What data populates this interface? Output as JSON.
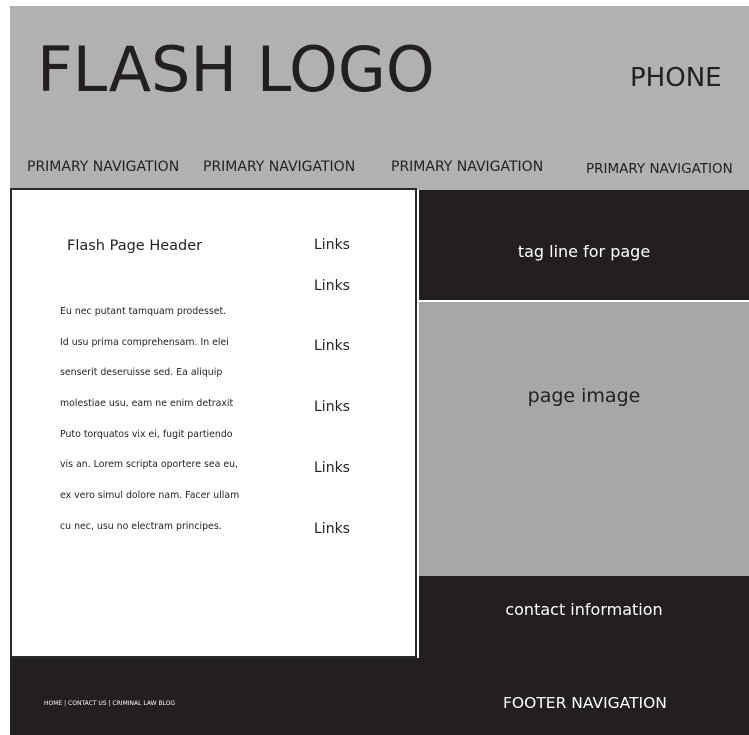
{
  "header": {
    "logo": "FLASH LOGO",
    "phone": "PHONE",
    "nav": [
      "PRIMARY NAVIGATION",
      "PRIMARY NAVIGATION",
      "PRIMARY NAVIGATION",
      "PRIMARY NAVIGATION"
    ]
  },
  "content": {
    "page_header": "Flash Page Header",
    "body_lines": [
      "Eu nec putant tamquam prodesset.",
      "Id usu prima comprehensam. In elei",
      "senserit deseruisse sed. Ea aliquip",
      "molestiae usu, eam ne enim detraxit",
      "Puto torquatos vix ei, fugit partiendo",
      "vis an. Lorem scripta oportere sea eu,",
      "ex vero simul dolore nam. Facer ullam",
      "cu nec, usu no electram principes."
    ],
    "links": [
      "Links",
      "Links",
      "Links",
      "Links",
      "Links",
      "Links"
    ]
  },
  "side": {
    "tagline": "tag line for page",
    "image_placeholder": "page image",
    "contact": "contact information"
  },
  "footer": {
    "links": "HOME | CONTACT US | CRIMINAL LAW BLOG",
    "navigation": "FOOTER NAVIGATION"
  },
  "colors": {
    "header_bg": "#b1b1b1",
    "dark": "#231f20",
    "image_bg": "#a7a7a7",
    "white": "#ffffff"
  }
}
